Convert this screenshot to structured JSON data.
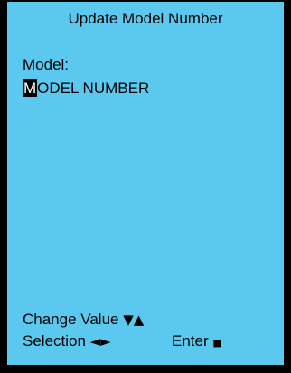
{
  "screen": {
    "title": "Update Model Number",
    "field_label": "Model:",
    "field_value_cursor_char": "M",
    "field_value_rest": "ODEL NUMBER",
    "change_value_label": "Change Value",
    "change_value_icon": "▼▲",
    "selection_label": "Selection",
    "selection_icon": "◄►",
    "enter_label": "Enter",
    "enter_icon": "■"
  },
  "colors": {
    "background": "#5bc8ef",
    "border": "#000000",
    "text": "#000000",
    "cursor_bg": "#000000",
    "cursor_fg": "#ffffff"
  }
}
